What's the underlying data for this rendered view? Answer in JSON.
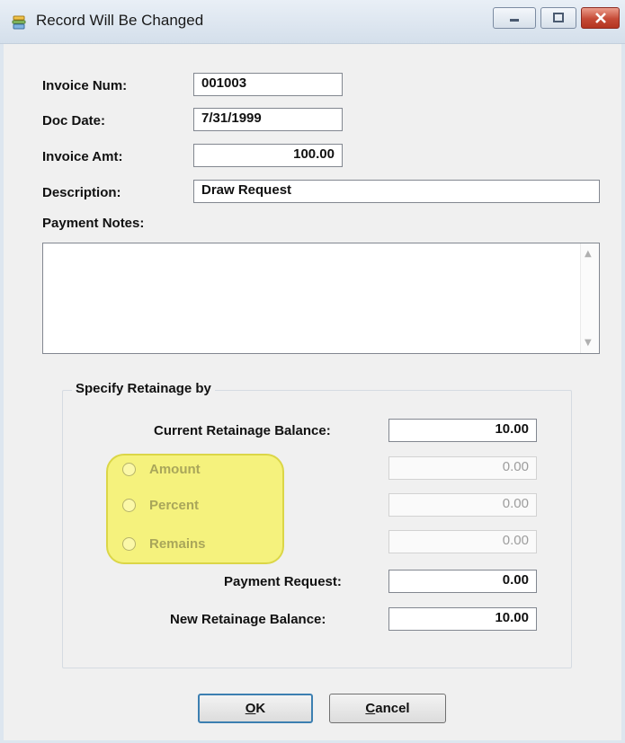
{
  "window": {
    "title": "Record Will Be Changed"
  },
  "form": {
    "invoice_num_label": "Invoice Num:",
    "invoice_num_value": "001003",
    "doc_date_label": "Doc Date:",
    "doc_date_value": "7/31/1999",
    "invoice_amt_label": "Invoice Amt:",
    "invoice_amt_value": "100.00",
    "description_label": "Description:",
    "description_value": "Draw Request",
    "payment_notes_label": "Payment Notes:",
    "payment_notes_value": ""
  },
  "retainage": {
    "group_title": "Specify Retainage by",
    "current_balance_label": "Current Retainage Balance:",
    "current_balance_value": "10.00",
    "options": [
      {
        "label": "Amount",
        "value": "0.00",
        "selected": false
      },
      {
        "label": "Percent",
        "value": "0.00",
        "selected": false
      },
      {
        "label": "Remains",
        "value": "0.00",
        "selected": false
      }
    ],
    "payment_request_label": "Payment Request:",
    "payment_request_value": "0.00",
    "new_balance_label": "New Retainage Balance:",
    "new_balance_value": "10.00"
  },
  "buttons": {
    "ok_mnemonic": "O",
    "ok_rest": "K",
    "cancel_mnemonic": "C",
    "cancel_rest": "ancel"
  },
  "colors": {
    "highlight": "#f6f36a",
    "default_button_border": "#3c7fb1",
    "close_button": "#c54a36"
  },
  "icons": [
    "app-icon",
    "minimize-icon",
    "maximize-icon",
    "close-icon",
    "scroll-up-icon",
    "scroll-down-icon"
  ]
}
